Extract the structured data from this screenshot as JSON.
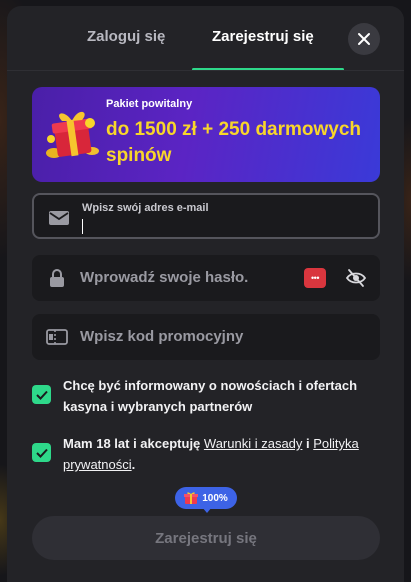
{
  "tabs": {
    "login_label": "Zaloguj się",
    "register_label": "Zarejestruj się",
    "active": "register"
  },
  "banner": {
    "small_text": "Pakiet powitalny",
    "big_text": "do 1500 zł + 250 darmowych spinów"
  },
  "form": {
    "email": {
      "label": "Wpisz swój adres e-mail",
      "value": ""
    },
    "password": {
      "placeholder": "Wprowadź swoje hasło.",
      "badge": "•••"
    },
    "promo": {
      "placeholder": "Wpisz kod promocyjny"
    }
  },
  "consents": {
    "marketing": {
      "text": "Chcę być informowany o nowościach i ofertach kasyna i wybranych partnerów",
      "checked": true
    },
    "age": {
      "text_before": "Mam 18 lat i akceptuję ",
      "terms_link": "Warunki i zasady",
      "text_middle": " i ",
      "privacy_link": "Polityka prywatności",
      "text_after": ".",
      "checked": true
    }
  },
  "progress": {
    "label": "100%",
    "value": 1.0
  },
  "submit": {
    "label": "Zarejestruj się",
    "enabled": false
  },
  "colors": {
    "accent": "#2ed88a",
    "banner_gradient_start": "#4a1fa8",
    "banner_gradient_end": "#3a3ad8",
    "banner_highlight": "#f8d62a",
    "progress_badge": "#3d63e6"
  },
  "icons": {
    "close": "close-icon",
    "email": "envelope-icon",
    "password": "lock-icon",
    "password_toggle": "eye-slash-icon",
    "promo": "ticket-icon",
    "gift": "gift-icon",
    "check": "check-icon"
  }
}
